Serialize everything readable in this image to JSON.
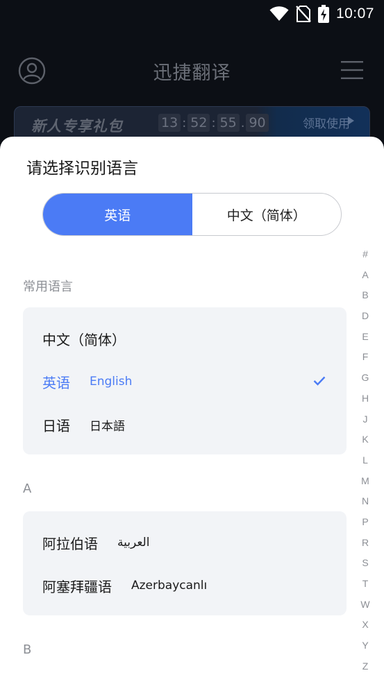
{
  "status_bar": {
    "time": "10:07",
    "icons": [
      "wifi-icon",
      "no-sim-icon",
      "battery-charging-icon"
    ]
  },
  "header": {
    "title": "迅捷翻译",
    "left_icon": "user-avatar-icon",
    "right_icon": "menu-icon"
  },
  "promo": {
    "title": "新人专享礼包",
    "timer": [
      "13",
      "52",
      "55",
      "90"
    ],
    "timer_separators": [
      ":",
      ":",
      "."
    ],
    "claim_label": "领取使用"
  },
  "sheet": {
    "title": "请选择识别语言",
    "segments": [
      {
        "label": "英语",
        "active": true
      },
      {
        "label": "中文（简体）",
        "active": false
      }
    ],
    "sections": [
      {
        "label": "常用语言",
        "items": [
          {
            "name": "中文（简体）",
            "native": ""
          },
          {
            "name": "英语",
            "native": "English",
            "selected": true
          },
          {
            "name": "日语",
            "native": "日本語"
          }
        ]
      },
      {
        "label": "A",
        "items": [
          {
            "name": "阿拉伯语",
            "native": "العربية"
          },
          {
            "name": "阿塞拜疆语",
            "native": "Azerbaycanlı"
          }
        ]
      },
      {
        "label": "B",
        "items": []
      }
    ],
    "index": [
      "#",
      "A",
      "B",
      "D",
      "E",
      "F",
      "G",
      "H",
      "J",
      "K",
      "L",
      "M",
      "N",
      "P",
      "R",
      "S",
      "T",
      "W",
      "X",
      "Y",
      "Z"
    ]
  },
  "colors": {
    "accent": "#4b7bf5",
    "background_dim": "#0c0f15",
    "card_bg": "#f2f4f7",
    "muted_text": "#8c8f95"
  }
}
